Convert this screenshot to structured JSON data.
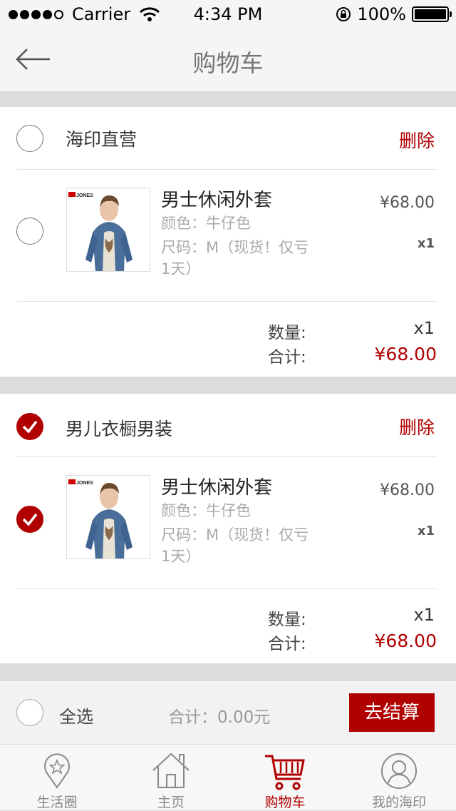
{
  "status_bar": {
    "carrier": "Carrier",
    "time": "4:34 PM",
    "battery": "100%"
  },
  "nav": {
    "title": "购物车",
    "back_icon": "back-arrow-icon"
  },
  "shops": [
    {
      "name": "海印直营",
      "checked": false,
      "delete_label": "删除",
      "item": {
        "brand": "JONES",
        "name": "男士休闲外套",
        "color": "颜色：牛仔色",
        "size": "尺码：M（现货！仅亏1天）",
        "price": "¥68.00",
        "qty": "x1",
        "checked": false
      },
      "summary": {
        "qty_label": "数量:",
        "qty_value": "x1",
        "total_label": "合计:",
        "total_value": "¥68.00"
      }
    },
    {
      "name": "男儿衣橱男装",
      "checked": true,
      "delete_label": "删除",
      "item": {
        "brand": "JONES",
        "name": "男士休闲外套",
        "color": "颜色：牛仔色",
        "size": "尺码：M（现货！仅亏1天）",
        "price": "¥68.00",
        "qty": "x1",
        "checked": true
      },
      "summary": {
        "qty_label": "数量:",
        "qty_value": "x1",
        "total_label": "合计:",
        "total_value": "¥68.00"
      }
    }
  ],
  "bottom_bar": {
    "select_all_label": "全选",
    "total_label": "合计：0.00元",
    "checkout_label": "去结算"
  },
  "tabs": [
    {
      "label": "生活圈",
      "icon": "location-star-icon",
      "active": false
    },
    {
      "label": "主页",
      "icon": "home-icon",
      "active": false
    },
    {
      "label": "购物车",
      "icon": "cart-icon",
      "active": true
    },
    {
      "label": "我的海印",
      "icon": "user-icon",
      "active": false
    }
  ],
  "colors": {
    "accent": "#b00000",
    "background": "#dcdcdc",
    "card": "#ffffff"
  }
}
